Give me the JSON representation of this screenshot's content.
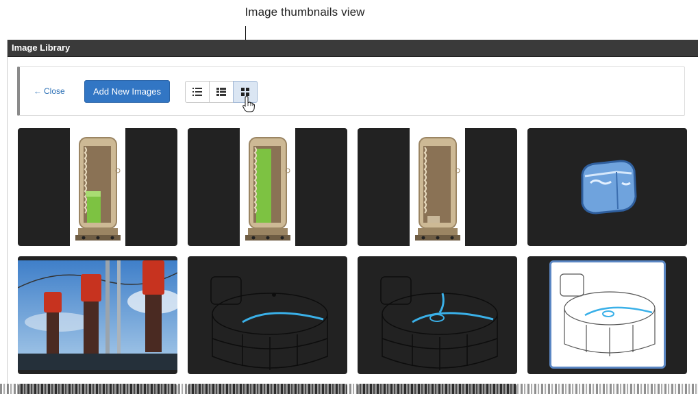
{
  "annotation": {
    "caption": "Image thumbnails view"
  },
  "window": {
    "title": "Image Library"
  },
  "toolbar": {
    "close_label": "Close",
    "add_label": "Add New Images",
    "views": [
      {
        "name": "list-view",
        "icon": "list-icon",
        "active": false
      },
      {
        "name": "detail-list-view",
        "icon": "detail-list-icon",
        "active": false
      },
      {
        "name": "thumbnails-view",
        "icon": "grid-icon",
        "active": true
      }
    ]
  },
  "colors": {
    "titlebar": "#3a3a3a",
    "primary_button": "#3276c4",
    "tile_background": "#222222",
    "link": "#2a6fb5"
  },
  "thumbnails": [
    {
      "name": "thumb-tank-low-level",
      "icon": "tank-low-icon"
    },
    {
      "name": "thumb-tank-full-level",
      "icon": "tank-full-icon"
    },
    {
      "name": "thumb-tank-empty",
      "icon": "tank-empty-icon"
    },
    {
      "name": "thumb-ice-cube",
      "icon": "ice-cube-icon"
    },
    {
      "name": "thumb-power-insulators",
      "icon": "insulator-photo-icon"
    },
    {
      "name": "thumb-reservoir-outline",
      "icon": "reservoir-outline-icon"
    },
    {
      "name": "thumb-reservoir-filling",
      "icon": "reservoir-filling-icon"
    },
    {
      "name": "thumb-reservoir-framed",
      "icon": "reservoir-framed-icon"
    }
  ]
}
